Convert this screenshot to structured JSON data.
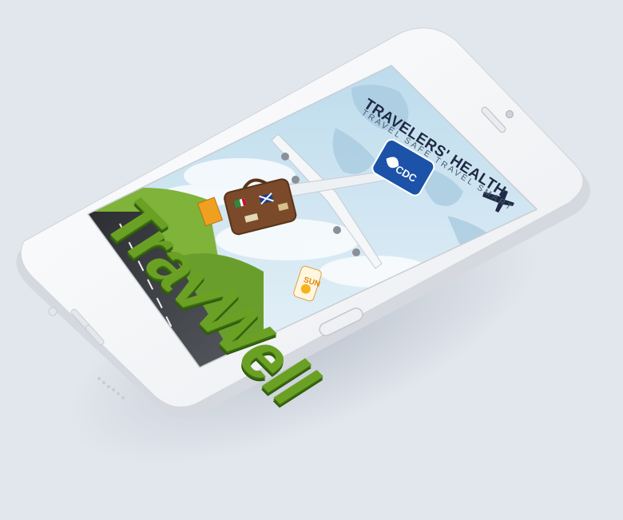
{
  "app": {
    "title": "TRAVELERS' HEALTH",
    "tagline": "TRAVEL SAFE TRAVEL SMART",
    "logo_text": "CDC",
    "hero_text": "TravWell",
    "sunscreen_label": "SUN"
  },
  "icons": {
    "plane": "plane-icon",
    "logo": "hhs-cdc-logo"
  },
  "colors": {
    "background": "#e2e7ee",
    "phone_body": "#f7f8fa",
    "screen_sky": "#cfe5f1",
    "logo_blue": "#1c52a8",
    "title": "#1f2a44",
    "grass": "#6aa124",
    "road": "#3c3e42"
  }
}
